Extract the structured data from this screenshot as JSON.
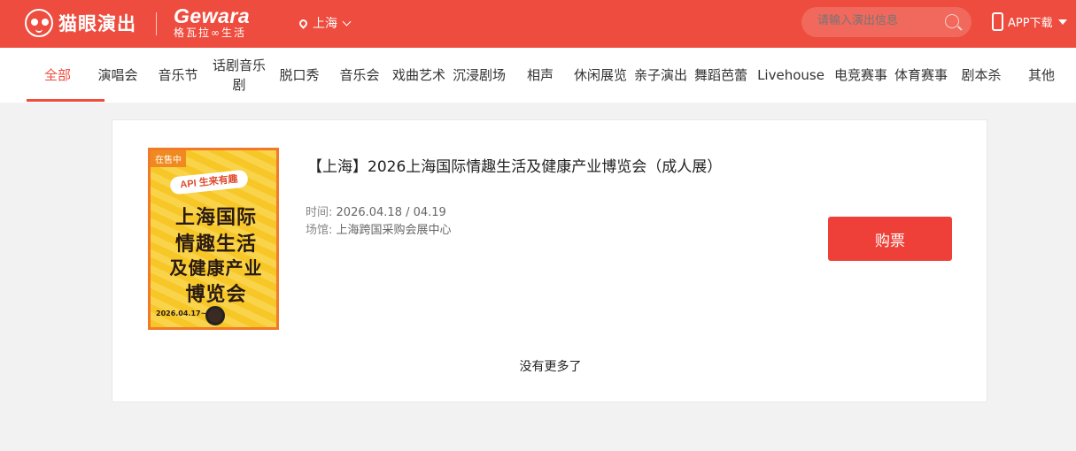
{
  "header": {
    "maoyan_brand": "猫眼演出",
    "gewara_brand": "Gewara",
    "gewara_sub": "格瓦拉∞生活",
    "city": "上海",
    "search_placeholder": "请输入演出信息",
    "app_download": "APP下载",
    "bg_color": "#ee4c3e"
  },
  "nav": {
    "items": [
      {
        "label": "全部",
        "active": true
      },
      {
        "label": "演唱会"
      },
      {
        "label": "音乐节"
      },
      {
        "label": "话剧音乐剧"
      },
      {
        "label": "脱口秀"
      },
      {
        "label": "音乐会"
      },
      {
        "label": "戏曲艺术"
      },
      {
        "label": "沉浸剧场"
      },
      {
        "label": "相声"
      },
      {
        "label": "休闲展览"
      },
      {
        "label": "亲子演出"
      },
      {
        "label": "舞蹈芭蕾"
      },
      {
        "label": "Livehouse"
      },
      {
        "label": "电竞赛事"
      },
      {
        "label": "体育赛事"
      },
      {
        "label": "剧本杀"
      },
      {
        "label": "其他"
      }
    ],
    "accent_color": "#ee4c3e"
  },
  "event": {
    "poster": {
      "tag": "在售中",
      "banner": "API 生来有趣",
      "lines": [
        "上海国际",
        "情趣生活",
        "及健康产业",
        "博览会"
      ],
      "date": "2026.04.17~19"
    },
    "title": "【上海】2026上海国际情趣生活及健康产业博览会（成人展）",
    "time_label": "时间:",
    "time_value": "2026.04.18 / 04.19",
    "venue_label": "场馆:",
    "venue_value": "上海跨国采购会展中心",
    "buy_label": "购票"
  },
  "footer": {
    "no_more": "没有更多了"
  }
}
